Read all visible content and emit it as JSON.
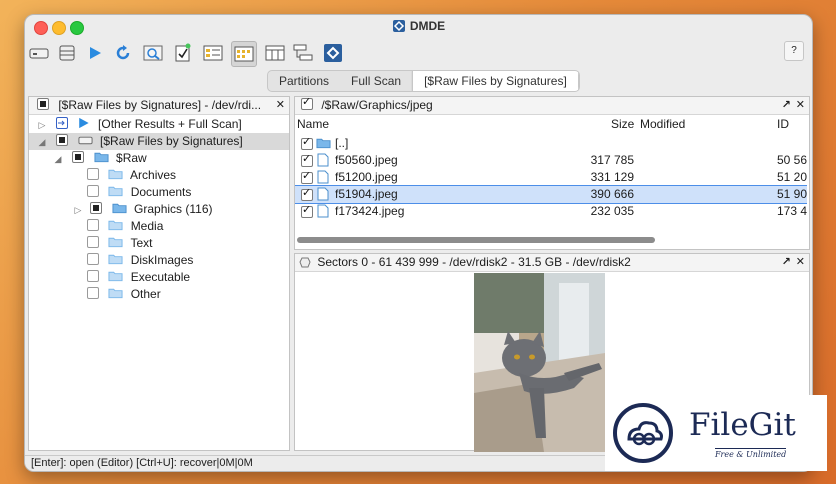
{
  "window": {
    "title": "DMDE"
  },
  "toolbar": {
    "help_label": "?"
  },
  "tabs": [
    {
      "label": "Partitions",
      "selected": false
    },
    {
      "label": "Full Scan",
      "selected": false
    },
    {
      "label": "[$Raw Files by Signatures]",
      "selected": true
    }
  ],
  "left_pane": {
    "header": "[$Raw Files by Signatures] - /dev/rdi...",
    "close_label": "✕",
    "tree": [
      {
        "label": "[Other Results + Full Scan]"
      },
      {
        "label": "[$Raw Files by Signatures]"
      },
      {
        "label": "$Raw"
      },
      {
        "label": "Archives"
      },
      {
        "label": "Documents"
      },
      {
        "label": "Graphics (116)"
      },
      {
        "label": "Media"
      },
      {
        "label": "Text"
      },
      {
        "label": "DiskImages"
      },
      {
        "label": "Executable"
      },
      {
        "label": "Other"
      }
    ]
  },
  "file_pane": {
    "path": "/$Raw/Graphics/jpeg",
    "maximize_label": "↗",
    "close_label": "✕",
    "columns": {
      "name": "Name",
      "size": "Size",
      "modified": "Modified",
      "id": "ID"
    },
    "rows": [
      {
        "name": "[..]",
        "size": "",
        "modified": "",
        "id": ""
      },
      {
        "name": "f50560.jpeg",
        "size": "317 785",
        "modified": "",
        "id": "50 56"
      },
      {
        "name": "f51200.jpeg",
        "size": "331 129",
        "modified": "",
        "id": "51 20"
      },
      {
        "name": "f51904.jpeg",
        "size": "390 666",
        "modified": "",
        "id": "51 90"
      },
      {
        "name": "f173424.jpeg",
        "size": "232 035",
        "modified": "",
        "id": "173 4"
      }
    ]
  },
  "preview_pane": {
    "header": "Sectors 0 - 61 439 999 - /dev/rdisk2 - 31.5 GB - /dev/rdisk2",
    "maximize_label": "↗",
    "close_label": "✕"
  },
  "status_bar": {
    "text": "[Enter]: open (Editor)  [Ctrl+U]: recover|0M|0M"
  },
  "watermark": {
    "name": "FileGit",
    "tagline": "Free & Unlimited"
  },
  "colors": {
    "selection": "#cfe1fa",
    "selection_border": "#4c8ee8",
    "accent_blue": "#2a7fd6",
    "folder": "#7ab7ea"
  }
}
